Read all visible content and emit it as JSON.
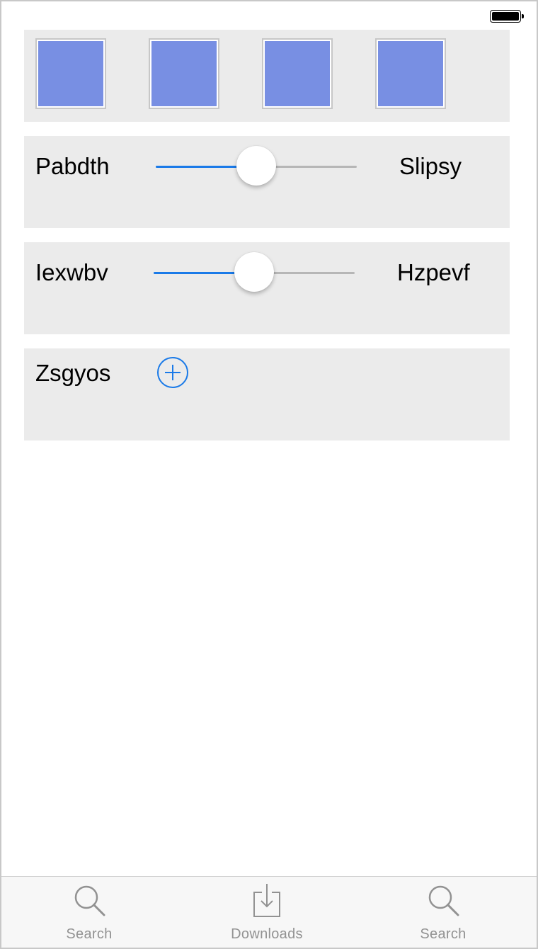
{
  "status_bar": {
    "battery_icon": "battery-full-icon"
  },
  "thumbnails": [
    {
      "color": "#788fe3"
    },
    {
      "color": "#788fe3"
    },
    {
      "color": "#788fe3"
    },
    {
      "color": "#788fe3"
    }
  ],
  "slider_rows": [
    {
      "left_label": "Pabdth",
      "right_label": "Slipsy",
      "value": 0.5
    },
    {
      "left_label": "Iexwbv",
      "right_label": "Hzpevf",
      "value": 0.5
    }
  ],
  "add_row": {
    "label": "Zsgyos",
    "button_icon": "plus-circle-icon"
  },
  "colors": {
    "accent": "#1a7ae8",
    "track": "#b6b6b6",
    "card": "#ebebeb"
  },
  "tabbar": {
    "tabs": [
      {
        "label": "Search",
        "icon": "search-icon"
      },
      {
        "label": "Downloads",
        "icon": "download-icon"
      },
      {
        "label": "Search",
        "icon": "search-icon"
      }
    ]
  }
}
